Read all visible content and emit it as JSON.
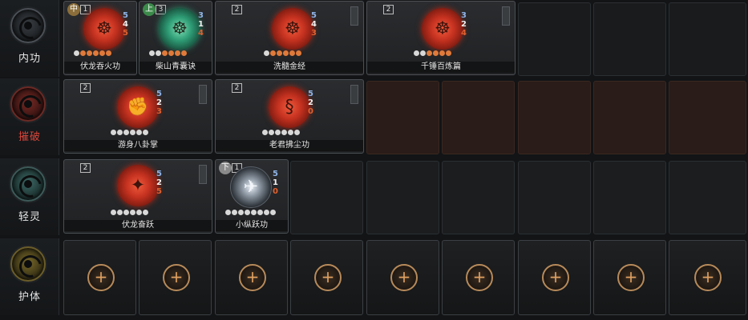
{
  "categories": [
    {
      "label": "内功",
      "icon": "meditation-emblem-icon"
    },
    {
      "label": "摧破",
      "icon": "fist-emblem-icon"
    },
    {
      "label": "轻灵",
      "icon": "wind-emblem-icon"
    },
    {
      "label": "护体",
      "icon": "shield-emblem-icon"
    }
  ],
  "skills": {
    "neigong": [
      {
        "name": "伏龙吞火功",
        "grade": "中",
        "count": "1",
        "stats": [
          "5",
          "4",
          "5"
        ],
        "icon": "meditating-figure-icon",
        "color": "#c4311f"
      },
      {
        "name": "柴山青囊诀",
        "grade": "上",
        "count": "3",
        "stats": [
          "3",
          "1",
          "4"
        ],
        "icon": "meditating-figure-icon",
        "color": "#2e9c75"
      },
      {
        "name": "洗髓金经",
        "grade": "",
        "count": "2",
        "stats": [
          "5",
          "4",
          "3"
        ],
        "icon": "meditating-figure-icon",
        "color": "#c4311f"
      },
      {
        "name": "千锤百炼篇",
        "grade": "",
        "count": "2",
        "stats": [
          "3",
          "2",
          "4"
        ],
        "icon": "meditating-figure-icon",
        "color": "#c4311f"
      }
    ],
    "cuipo": [
      {
        "name": "游身八卦掌",
        "grade": "",
        "count": "2",
        "stats": [
          "5",
          "2",
          "3"
        ],
        "icon": "palm-strike-icon",
        "color": "#c4311f"
      },
      {
        "name": "老君拂尘功",
        "grade": "",
        "count": "2",
        "stats": [
          "5",
          "2",
          "0"
        ],
        "icon": "whisk-icon",
        "color": "#c4311f"
      }
    ],
    "qingling": [
      {
        "name": "伏龙奋跃",
        "grade": "",
        "count": "2",
        "stats": [
          "5",
          "2",
          "5"
        ],
        "icon": "leaping-figure-icon",
        "color": "#c4311f"
      },
      {
        "name": "小纵跃功",
        "grade": "下",
        "count": "1",
        "stats": [
          "5",
          "1",
          "0"
        ],
        "icon": "leaping-figure-icon",
        "color": "#e8eef5"
      }
    ]
  },
  "add_label": "+"
}
